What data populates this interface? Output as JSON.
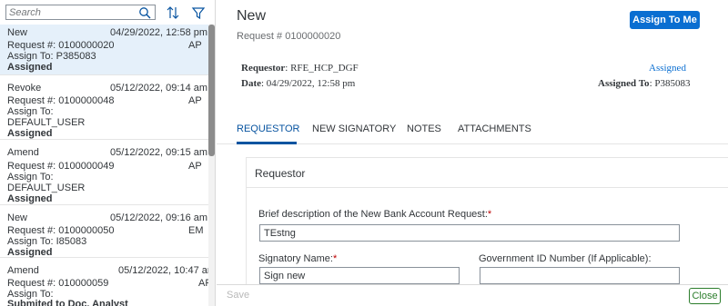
{
  "search": {
    "placeholder": "Search",
    "value": ""
  },
  "list": {
    "items": [
      {
        "type": "New",
        "date": "04/29/2022, 12:58 pm",
        "request": "Request #: 0100000020",
        "code": "AP",
        "assign_line1": "Assign To: P385083",
        "assign_line2": "",
        "status": "Assigned",
        "selected": true
      },
      {
        "type": "Revoke",
        "date": "05/12/2022, 09:14 am",
        "request": "Request #: 0100000048",
        "code": "AP",
        "assign_line1": "Assign To:",
        "assign_line2": "DEFAULT_USER",
        "status": "Assigned",
        "selected": false
      },
      {
        "type": "Amend",
        "date": "05/12/2022, 09:15 am",
        "request": "Request #: 0100000049",
        "code": "AP",
        "assign_line1": "Assign To:",
        "assign_line2": "DEFAULT_USER",
        "status": "Assigned",
        "selected": false
      },
      {
        "type": "New",
        "date": "05/12/2022, 09:16 am",
        "request": "Request #: 0100000050",
        "code": "EM",
        "assign_line1": "Assign To: I85083",
        "assign_line2": "",
        "status": "Assigned",
        "selected": false
      },
      {
        "type": "Amend",
        "date": "05/12/2022, 10:47 am",
        "request": "Request #: 010000059",
        "code": "AF",
        "assign_line1": "Assign To:",
        "assign_line2": "",
        "status": "Submited to Doc. Analyst",
        "selected": false
      }
    ]
  },
  "detail": {
    "title": "New",
    "subtitle": "Request # 0100000020",
    "assign_button": "Assign To Me",
    "requestor_label": "Requestor",
    "requestor_value": ": RFE_HCP_DGF",
    "date_label": "Date",
    "date_value": ": 04/29/2022, 12:58 pm",
    "status_link": "Assigned",
    "assigned_to_label": "Assigned To",
    "assigned_to_value": ": P385083",
    "tabs": [
      "REQUESTOR",
      "NEW SIGNATORY",
      "NOTES",
      "ATTACHMENTS"
    ],
    "section_title": "Requestor",
    "brief_label": "Brief description of the New Bank Account Request:",
    "brief_value": "TEstng",
    "signatory_label": "Signatory Name:",
    "signatory_value": "Sign new",
    "govid_label": "Government ID Number (If Applicable):",
    "govid_value": "",
    "required_mark": "*"
  },
  "footer": {
    "save": "Save",
    "close": "Close"
  },
  "colors": {
    "accent": "#0a6ed1",
    "selected_bg": "#e5f0fa",
    "close_green": "#2b7d2b",
    "required": "#bb0000"
  }
}
